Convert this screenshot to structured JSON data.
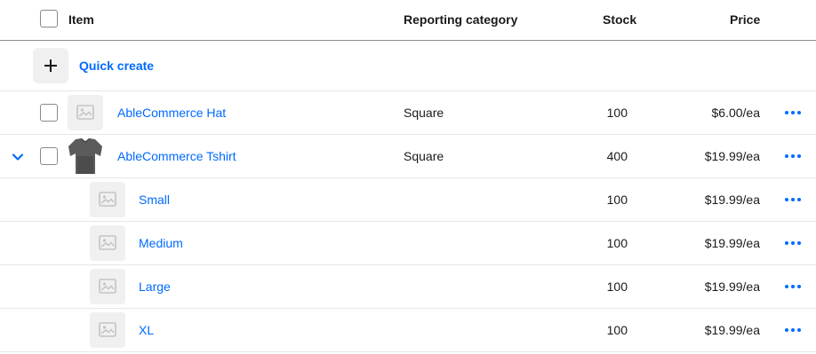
{
  "header": {
    "item": "Item",
    "category": "Reporting category",
    "stock": "Stock",
    "price": "Price"
  },
  "quick_create": {
    "label": "Quick create"
  },
  "rows": [
    {
      "name": "AbleCommerce Hat",
      "category": "Square",
      "stock": "100",
      "price": "$6.00/ea",
      "thumb": "image-placeholder-icon"
    },
    {
      "name": "AbleCommerce Tshirt",
      "category": "Square",
      "stock": "400",
      "price": "$19.99/ea",
      "thumb": "tshirt-image",
      "expanded": true
    },
    {
      "name": "Small",
      "category": "",
      "stock": "100",
      "price": "$19.99/ea",
      "thumb": "image-placeholder-icon"
    },
    {
      "name": "Medium",
      "category": "",
      "stock": "100",
      "price": "$19.99/ea",
      "thumb": "image-placeholder-icon"
    },
    {
      "name": "Large",
      "category": "",
      "stock": "100",
      "price": "$19.99/ea",
      "thumb": "image-placeholder-icon"
    },
    {
      "name": "XL",
      "category": "",
      "stock": "100",
      "price": "$19.99/ea",
      "thumb": "image-placeholder-icon"
    }
  ],
  "colors": {
    "accent": "#006aff",
    "text": "#1a1a1a",
    "placeholder_bg": "#f0f0f0",
    "divider": "#e6e6e6"
  }
}
